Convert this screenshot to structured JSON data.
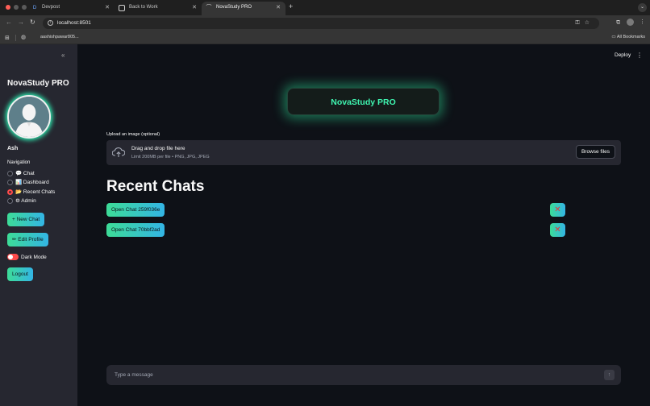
{
  "browser": {
    "tabs": [
      {
        "title": "Devpost",
        "favicon": "D"
      },
      {
        "title": "Back to Work",
        "favicon": ""
      },
      {
        "title": "NovaStudy PRO",
        "favicon": ""
      }
    ],
    "active_tab": 2,
    "url": "localhost:8501",
    "bookmark": "aashishpawar805...",
    "all_bookmarks": "All Bookmarks"
  },
  "sidebar": {
    "title": "NovaStudy PRO",
    "username": "Ash",
    "nav_label": "Navigation",
    "nav_items": [
      {
        "label": "💬 Chat",
        "checked": false
      },
      {
        "label": "📊 Dashboard",
        "checked": false
      },
      {
        "label": "📂 Recent Chats",
        "checked": true
      },
      {
        "label": "⚙ Admin",
        "checked": false
      }
    ],
    "new_chat": "+ New Chat",
    "edit_profile": "✏ Edit Profile",
    "dark_mode": "Dark Mode",
    "logout": "Logout"
  },
  "header": {
    "deploy": "Deploy"
  },
  "main": {
    "hero_title": "NovaStudy PRO",
    "upload_label": "Upload an image (optional)",
    "dropzone_title": "Drag and drop file here",
    "dropzone_sub": "Limit 200MB per file • PNG, JPG, JPEG",
    "browse": "Browse files",
    "section_title": "Recent Chats",
    "chats": [
      {
        "label": "Open Chat 259f036e",
        "delete": "✕"
      },
      {
        "label": "Open Chat 70bbf2ad",
        "delete": "✕"
      }
    ],
    "input_placeholder": "Type a message"
  },
  "colors": {
    "accent_green": "#3ff5b0",
    "radio_active": "#ff4b4b"
  }
}
